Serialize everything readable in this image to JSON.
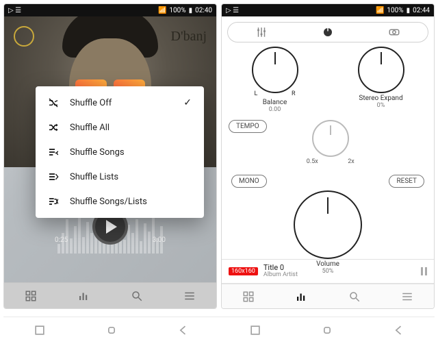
{
  "left": {
    "status": {
      "signal": "▲",
      "wifi": "᚛",
      "battery": "100%",
      "time": "02:40",
      "indicators": "▷ ☰"
    },
    "artist_signature": "D'banj",
    "time_elapsed": "0:25",
    "time_total": "3:00",
    "popup": {
      "items": [
        {
          "icon": "shuffle-off-icon",
          "label": "Shuffle Off",
          "checked": true
        },
        {
          "icon": "shuffle-icon",
          "label": "Shuffle All",
          "checked": false
        },
        {
          "icon": "shuffle-songs-icon",
          "label": "Shuffle Songs",
          "checked": false
        },
        {
          "icon": "shuffle-lists-icon",
          "label": "Shuffle Lists",
          "checked": false
        },
        {
          "icon": "shuffle-songs-lists-icon",
          "label": "Shuffle Songs/Lists",
          "checked": false
        }
      ]
    },
    "nav": [
      "library-icon",
      "equalizer-icon",
      "search-icon",
      "menu-icon"
    ]
  },
  "right": {
    "status": {
      "signal": "▲",
      "wifi": "᚛",
      "battery": "100%",
      "time": "02:44",
      "indicators": "▷ ☰"
    },
    "top_icons": [
      "sliders-icon",
      "dial-icon",
      "surround-icon"
    ],
    "balance": {
      "label": "Balance",
      "value": "0.00",
      "left": "L",
      "right": "R"
    },
    "stereo": {
      "label": "Stereo Expand",
      "value": "0%"
    },
    "tempo": {
      "button": "TEMPO",
      "min": "0.5x",
      "max": "2x"
    },
    "mono_button": "MONO",
    "reset_button": "RESET",
    "volume": {
      "label": "Volume",
      "value": "50%"
    },
    "nowplaying": {
      "badge": "160x160",
      "title": "Title 0",
      "subtitle": "Album Artist"
    },
    "nav": [
      "library-icon",
      "equalizer-icon",
      "search-icon",
      "menu-icon"
    ]
  },
  "softkeys": [
    "recents-icon",
    "home-icon",
    "back-icon",
    "recents-icon",
    "home-icon",
    "back-icon"
  ]
}
